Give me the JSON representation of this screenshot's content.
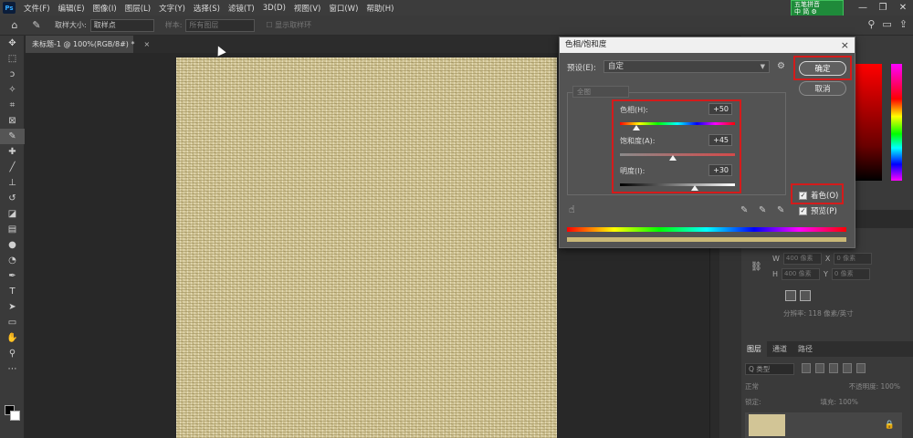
{
  "menubar": {
    "logo": "Ps",
    "items": [
      "文件(F)",
      "编辑(E)",
      "图像(I)",
      "图层(L)",
      "文字(Y)",
      "选择(S)",
      "滤镜(T)",
      "3D(D)",
      "视图(V)",
      "窗口(W)",
      "帮助(H)"
    ],
    "badge_line1": "五笔拼音",
    "badge_line2": "中 简 ⚙",
    "window_controls": [
      "—",
      "❐",
      "✕"
    ]
  },
  "optbar": {
    "sample_size_label": "取样大小:",
    "sample_size_value": "取样点",
    "sample_label": "样本:",
    "sample_value": "所有图层",
    "show_ring_label": "显示取样环"
  },
  "tab": {
    "title": "未标题-1 @ 100%(RGB/8#) *",
    "close": "×"
  },
  "dialog": {
    "title": "色相/饱和度",
    "close": "×",
    "preset_label": "预设(E):",
    "preset_value": "自定",
    "ok_label": "确定",
    "cancel_label": "取消",
    "channel_value": "全图",
    "hue_label": "色相(H):",
    "hue_value": "+50",
    "saturation_label": "饱和度(A):",
    "saturation_value": "+45",
    "lightness_label": "明度(I):",
    "lightness_value": "+30",
    "hue_fraction": 0.14,
    "saturation_fraction": 0.46,
    "lightness_fraction": 0.65,
    "colorize_label": "着色(O)",
    "preview_label": "预览(P)",
    "colorize_checked": true,
    "preview_checked": true
  },
  "properties": {
    "w_label": "W",
    "w_value": "400 像素",
    "x_label": "X",
    "x_value": "0 像素",
    "h_label": "H",
    "h_value": "400 像素",
    "y_label": "Y",
    "y_value": "0 像素",
    "resolution": "分辨率: 118 像素/英寸"
  },
  "layers": {
    "tabs": [
      "图层",
      "通道",
      "路径"
    ],
    "filter": "Q 类型",
    "blend_mode": "正常",
    "opacity_label": "不透明度:",
    "opacity_value": "100%",
    "lock_label": "锁定:",
    "fill_label": "填充:",
    "fill_value": "100%"
  },
  "colors": {
    "highlight": "#d41b1b",
    "canvas_texture": "#d2c596",
    "badge": "#1f8a3a"
  }
}
